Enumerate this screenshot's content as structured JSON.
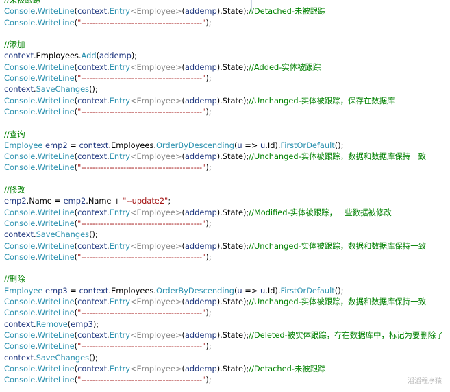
{
  "code_lines": [
    [
      {
        "c": "comment",
        "t": "//未被跟踪"
      }
    ],
    [
      {
        "c": "type",
        "t": "Console"
      },
      {
        "c": "plain",
        "t": "."
      },
      {
        "c": "type",
        "t": "WriteLine"
      },
      {
        "c": "plain",
        "t": "("
      },
      {
        "c": "prop",
        "t": "context"
      },
      {
        "c": "plain",
        "t": "."
      },
      {
        "c": "type",
        "t": "Entry"
      },
      {
        "c": "gen",
        "t": "<Employee>"
      },
      {
        "c": "plain",
        "t": "("
      },
      {
        "c": "prop",
        "t": "addemp"
      },
      {
        "c": "plain",
        "t": ").State);"
      },
      {
        "c": "comment",
        "t": "//Detached-未被跟踪"
      }
    ],
    [
      {
        "c": "type",
        "t": "Console"
      },
      {
        "c": "plain",
        "t": "."
      },
      {
        "c": "type",
        "t": "WriteLine"
      },
      {
        "c": "plain",
        "t": "("
      },
      {
        "c": "str",
        "t": "\"-------------------------------------------\""
      },
      {
        "c": "plain",
        "t": ");"
      }
    ],
    [],
    [
      {
        "c": "comment",
        "t": "//添加"
      }
    ],
    [
      {
        "c": "prop",
        "t": "context"
      },
      {
        "c": "plain",
        "t": ".Employees."
      },
      {
        "c": "type",
        "t": "Add"
      },
      {
        "c": "plain",
        "t": "("
      },
      {
        "c": "prop",
        "t": "addemp"
      },
      {
        "c": "plain",
        "t": ");"
      }
    ],
    [
      {
        "c": "type",
        "t": "Console"
      },
      {
        "c": "plain",
        "t": "."
      },
      {
        "c": "type",
        "t": "WriteLine"
      },
      {
        "c": "plain",
        "t": "("
      },
      {
        "c": "prop",
        "t": "context"
      },
      {
        "c": "plain",
        "t": "."
      },
      {
        "c": "type",
        "t": "Entry"
      },
      {
        "c": "gen",
        "t": "<Employee>"
      },
      {
        "c": "plain",
        "t": "("
      },
      {
        "c": "prop",
        "t": "addemp"
      },
      {
        "c": "plain",
        "t": ").State);"
      },
      {
        "c": "comment",
        "t": "//Added-实体被跟踪"
      }
    ],
    [
      {
        "c": "type",
        "t": "Console"
      },
      {
        "c": "plain",
        "t": "."
      },
      {
        "c": "type",
        "t": "WriteLine"
      },
      {
        "c": "plain",
        "t": "("
      },
      {
        "c": "str",
        "t": "\"-------------------------------------------\""
      },
      {
        "c": "plain",
        "t": ");"
      }
    ],
    [
      {
        "c": "prop",
        "t": "context"
      },
      {
        "c": "plain",
        "t": "."
      },
      {
        "c": "type",
        "t": "SaveChanges"
      },
      {
        "c": "plain",
        "t": "();"
      }
    ],
    [
      {
        "c": "type",
        "t": "Console"
      },
      {
        "c": "plain",
        "t": "."
      },
      {
        "c": "type",
        "t": "WriteLine"
      },
      {
        "c": "plain",
        "t": "("
      },
      {
        "c": "prop",
        "t": "context"
      },
      {
        "c": "plain",
        "t": "."
      },
      {
        "c": "type",
        "t": "Entry"
      },
      {
        "c": "gen",
        "t": "<Employee>"
      },
      {
        "c": "plain",
        "t": "("
      },
      {
        "c": "prop",
        "t": "addemp"
      },
      {
        "c": "plain",
        "t": ").State);"
      },
      {
        "c": "comment",
        "t": "//Unchanged-实体被跟踪，保存在数据库"
      }
    ],
    [
      {
        "c": "type",
        "t": "Console"
      },
      {
        "c": "plain",
        "t": "."
      },
      {
        "c": "type",
        "t": "WriteLine"
      },
      {
        "c": "plain",
        "t": "("
      },
      {
        "c": "str",
        "t": "\"-------------------------------------------\""
      },
      {
        "c": "plain",
        "t": ");"
      }
    ],
    [],
    [
      {
        "c": "comment",
        "t": "//查询"
      }
    ],
    [
      {
        "c": "type",
        "t": "Employee"
      },
      {
        "c": "plain",
        "t": " "
      },
      {
        "c": "prop",
        "t": "emp2"
      },
      {
        "c": "plain",
        "t": " = "
      },
      {
        "c": "prop",
        "t": "context"
      },
      {
        "c": "plain",
        "t": ".Employees."
      },
      {
        "c": "type",
        "t": "OrderByDescending"
      },
      {
        "c": "plain",
        "t": "("
      },
      {
        "c": "prop",
        "t": "u"
      },
      {
        "c": "plain",
        "t": " => "
      },
      {
        "c": "prop",
        "t": "u"
      },
      {
        "c": "plain",
        "t": ".Id)."
      },
      {
        "c": "type",
        "t": "FirstOrDefault"
      },
      {
        "c": "plain",
        "t": "();"
      }
    ],
    [
      {
        "c": "type",
        "t": "Console"
      },
      {
        "c": "plain",
        "t": "."
      },
      {
        "c": "type",
        "t": "WriteLine"
      },
      {
        "c": "plain",
        "t": "("
      },
      {
        "c": "prop",
        "t": "context"
      },
      {
        "c": "plain",
        "t": "."
      },
      {
        "c": "type",
        "t": "Entry"
      },
      {
        "c": "gen",
        "t": "<Employee>"
      },
      {
        "c": "plain",
        "t": "("
      },
      {
        "c": "prop",
        "t": "addemp"
      },
      {
        "c": "plain",
        "t": ").State);"
      },
      {
        "c": "comment",
        "t": "//Unchanged-实体被跟踪，数据和数据库保持一致"
      }
    ],
    [
      {
        "c": "type",
        "t": "Console"
      },
      {
        "c": "plain",
        "t": "."
      },
      {
        "c": "type",
        "t": "WriteLine"
      },
      {
        "c": "plain",
        "t": "("
      },
      {
        "c": "str",
        "t": "\"-------------------------------------------\""
      },
      {
        "c": "plain",
        "t": ");"
      }
    ],
    [],
    [
      {
        "c": "comment",
        "t": "//修改"
      }
    ],
    [
      {
        "c": "prop",
        "t": "emp2"
      },
      {
        "c": "plain",
        "t": ".Name = "
      },
      {
        "c": "prop",
        "t": "emp2"
      },
      {
        "c": "plain",
        "t": ".Name + "
      },
      {
        "c": "str",
        "t": "\"--update2\""
      },
      {
        "c": "plain",
        "t": ";"
      }
    ],
    [
      {
        "c": "type",
        "t": "Console"
      },
      {
        "c": "plain",
        "t": "."
      },
      {
        "c": "type",
        "t": "WriteLine"
      },
      {
        "c": "plain",
        "t": "("
      },
      {
        "c": "prop",
        "t": "context"
      },
      {
        "c": "plain",
        "t": "."
      },
      {
        "c": "type",
        "t": "Entry"
      },
      {
        "c": "gen",
        "t": "<Employee>"
      },
      {
        "c": "plain",
        "t": "("
      },
      {
        "c": "prop",
        "t": "addemp"
      },
      {
        "c": "plain",
        "t": ").State);"
      },
      {
        "c": "comment",
        "t": "//Modified-实体被跟踪，一些数据被修改"
      }
    ],
    [
      {
        "c": "type",
        "t": "Console"
      },
      {
        "c": "plain",
        "t": "."
      },
      {
        "c": "type",
        "t": "WriteLine"
      },
      {
        "c": "plain",
        "t": "("
      },
      {
        "c": "str",
        "t": "\"-------------------------------------------\""
      },
      {
        "c": "plain",
        "t": ");"
      }
    ],
    [
      {
        "c": "prop",
        "t": "context"
      },
      {
        "c": "plain",
        "t": "."
      },
      {
        "c": "type",
        "t": "SaveChanges"
      },
      {
        "c": "plain",
        "t": "();"
      }
    ],
    [
      {
        "c": "type",
        "t": "Console"
      },
      {
        "c": "plain",
        "t": "."
      },
      {
        "c": "type",
        "t": "WriteLine"
      },
      {
        "c": "plain",
        "t": "("
      },
      {
        "c": "prop",
        "t": "context"
      },
      {
        "c": "plain",
        "t": "."
      },
      {
        "c": "type",
        "t": "Entry"
      },
      {
        "c": "gen",
        "t": "<Employee>"
      },
      {
        "c": "plain",
        "t": "("
      },
      {
        "c": "prop",
        "t": "addemp"
      },
      {
        "c": "plain",
        "t": ").State);"
      },
      {
        "c": "comment",
        "t": "//Unchanged-实体被跟踪，数据和数据库保持一致"
      }
    ],
    [
      {
        "c": "type",
        "t": "Console"
      },
      {
        "c": "plain",
        "t": "."
      },
      {
        "c": "type",
        "t": "WriteLine"
      },
      {
        "c": "plain",
        "t": "("
      },
      {
        "c": "str",
        "t": "\"-------------------------------------------\""
      },
      {
        "c": "plain",
        "t": ");"
      }
    ],
    [],
    [
      {
        "c": "comment",
        "t": "//删除"
      }
    ],
    [
      {
        "c": "type",
        "t": "Employee"
      },
      {
        "c": "plain",
        "t": " "
      },
      {
        "c": "prop",
        "t": "emp3"
      },
      {
        "c": "plain",
        "t": " = "
      },
      {
        "c": "prop",
        "t": "context"
      },
      {
        "c": "plain",
        "t": ".Employees."
      },
      {
        "c": "type",
        "t": "OrderByDescending"
      },
      {
        "c": "plain",
        "t": "("
      },
      {
        "c": "prop",
        "t": "u"
      },
      {
        "c": "plain",
        "t": " => "
      },
      {
        "c": "prop",
        "t": "u"
      },
      {
        "c": "plain",
        "t": ".Id)."
      },
      {
        "c": "type",
        "t": "FirstOrDefault"
      },
      {
        "c": "plain",
        "t": "();"
      }
    ],
    [
      {
        "c": "type",
        "t": "Console"
      },
      {
        "c": "plain",
        "t": "."
      },
      {
        "c": "type",
        "t": "WriteLine"
      },
      {
        "c": "plain",
        "t": "("
      },
      {
        "c": "prop",
        "t": "context"
      },
      {
        "c": "plain",
        "t": "."
      },
      {
        "c": "type",
        "t": "Entry"
      },
      {
        "c": "gen",
        "t": "<Employee>"
      },
      {
        "c": "plain",
        "t": "("
      },
      {
        "c": "prop",
        "t": "addemp"
      },
      {
        "c": "plain",
        "t": ").State);"
      },
      {
        "c": "comment",
        "t": "//Unchanged-实体被跟踪，数据和数据库保持一致"
      }
    ],
    [
      {
        "c": "type",
        "t": "Console"
      },
      {
        "c": "plain",
        "t": "."
      },
      {
        "c": "type",
        "t": "WriteLine"
      },
      {
        "c": "plain",
        "t": "("
      },
      {
        "c": "str",
        "t": "\"-------------------------------------------\""
      },
      {
        "c": "plain",
        "t": ");"
      }
    ],
    [
      {
        "c": "prop",
        "t": "context"
      },
      {
        "c": "plain",
        "t": "."
      },
      {
        "c": "type",
        "t": "Remove"
      },
      {
        "c": "plain",
        "t": "("
      },
      {
        "c": "prop",
        "t": "emp3"
      },
      {
        "c": "plain",
        "t": ");"
      }
    ],
    [
      {
        "c": "type",
        "t": "Console"
      },
      {
        "c": "plain",
        "t": "."
      },
      {
        "c": "type",
        "t": "WriteLine"
      },
      {
        "c": "plain",
        "t": "("
      },
      {
        "c": "prop",
        "t": "context"
      },
      {
        "c": "plain",
        "t": "."
      },
      {
        "c": "type",
        "t": "Entry"
      },
      {
        "c": "gen",
        "t": "<Employee>"
      },
      {
        "c": "plain",
        "t": "("
      },
      {
        "c": "prop",
        "t": "addemp"
      },
      {
        "c": "plain",
        "t": ").State);"
      },
      {
        "c": "comment",
        "t": "//Deleted-被实体跟踪，存在数据库中，标记为要删除了"
      }
    ],
    [
      {
        "c": "type",
        "t": "Console"
      },
      {
        "c": "plain",
        "t": "."
      },
      {
        "c": "type",
        "t": "WriteLine"
      },
      {
        "c": "plain",
        "t": "("
      },
      {
        "c": "str",
        "t": "\"-------------------------------------------\""
      },
      {
        "c": "plain",
        "t": ");"
      }
    ],
    [
      {
        "c": "prop",
        "t": "context"
      },
      {
        "c": "plain",
        "t": "."
      },
      {
        "c": "type",
        "t": "SaveChanges"
      },
      {
        "c": "plain",
        "t": "();"
      }
    ],
    [
      {
        "c": "type",
        "t": "Console"
      },
      {
        "c": "plain",
        "t": "."
      },
      {
        "c": "type",
        "t": "WriteLine"
      },
      {
        "c": "plain",
        "t": "("
      },
      {
        "c": "prop",
        "t": "context"
      },
      {
        "c": "plain",
        "t": "."
      },
      {
        "c": "type",
        "t": "Entry"
      },
      {
        "c": "gen",
        "t": "<Employee>"
      },
      {
        "c": "plain",
        "t": "("
      },
      {
        "c": "prop",
        "t": "addemp"
      },
      {
        "c": "plain",
        "t": ").State);"
      },
      {
        "c": "comment",
        "t": "//Detached-未被跟踪"
      }
    ],
    [
      {
        "c": "type",
        "t": "Console"
      },
      {
        "c": "plain",
        "t": "."
      },
      {
        "c": "type",
        "t": "WriteLine"
      },
      {
        "c": "plain",
        "t": "("
      },
      {
        "c": "str",
        "t": "\"-------------------------------------------\""
      },
      {
        "c": "plain",
        "t": ");"
      }
    ]
  ],
  "watermark": "滔滔程序猿",
  "colors": {
    "comment": "#008000",
    "type": "#2b91af",
    "prop": "#1f377f",
    "generic": "#8a8a8a",
    "string": "#a31515",
    "plain": "#000000"
  }
}
